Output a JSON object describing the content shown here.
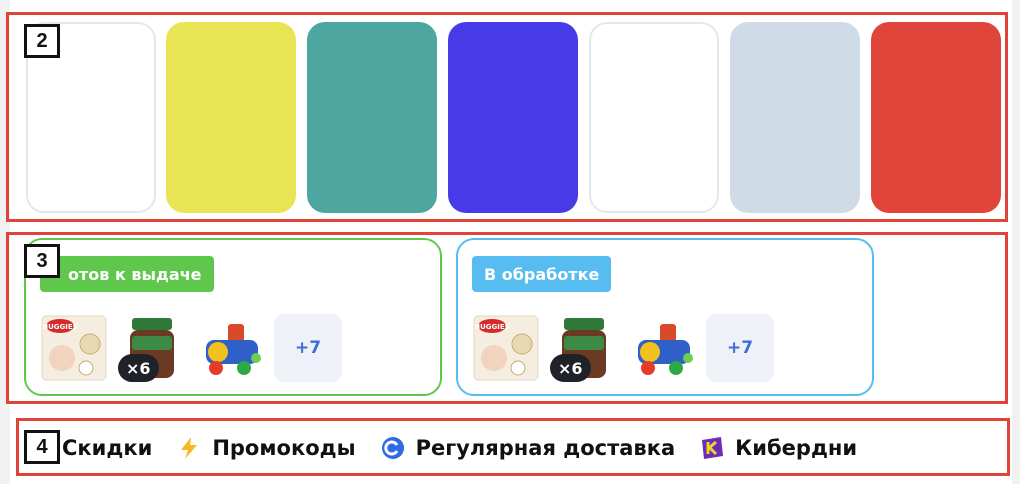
{
  "labels": {
    "sec2": "2",
    "sec3": "3",
    "sec4": "4"
  },
  "colors": {
    "frame": "#e0433a",
    "swatches": [
      "#ffffff",
      "#e8e453",
      "#4da6a0",
      "#463be6",
      "#ffffff",
      "#d0dbe8",
      "#e0453b"
    ],
    "ready": "#5fc84c",
    "processing": "#57bdf0"
  },
  "orders": [
    {
      "status": "Готов к выдаче",
      "status_visible": "отов к выдаче",
      "qty": "×6",
      "more": "+7",
      "products": [
        "diapers-pack-icon",
        "baby-food-jar-icon",
        "toy-train-icon"
      ]
    },
    {
      "status": "В обработке",
      "status_visible": "В обработке",
      "qty": "×6",
      "more": "+7",
      "products": [
        "diapers-pack-icon",
        "baby-food-jar-icon",
        "toy-train-icon"
      ]
    }
  ],
  "nav": {
    "discounts": "Скидки",
    "promocodes": "Промокоды",
    "regular_delivery": "Регулярная доставка",
    "kiberdni": "Кибердни"
  }
}
